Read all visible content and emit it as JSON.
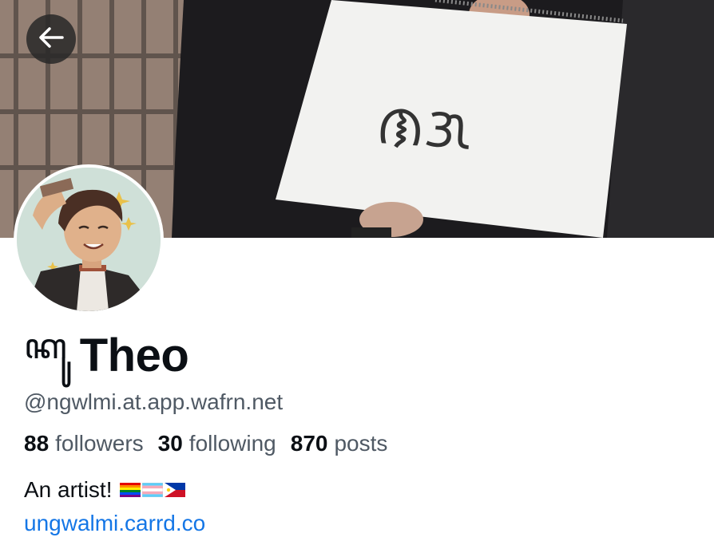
{
  "profile": {
    "display_glyphs": "ꦏꦸ",
    "display_name": "Theo",
    "handle": "@ngwlmi.at.app.wafrn.net",
    "bio_text": "An artist!",
    "link": "ungwalmi.carrd.co",
    "banner_sign_text": "ᜈᜄ"
  },
  "stats": {
    "followers_count": "88",
    "followers_label": "followers",
    "following_count": "30",
    "following_label": "following",
    "posts_count": "870",
    "posts_label": "posts"
  },
  "icons": {
    "back": "arrow-left-icon",
    "flags": [
      "rainbow-flag-icon",
      "trans-flag-icon",
      "philippines-flag-icon"
    ]
  },
  "colors": {
    "link": "#1476e6",
    "secondary_text": "#4f5964"
  }
}
